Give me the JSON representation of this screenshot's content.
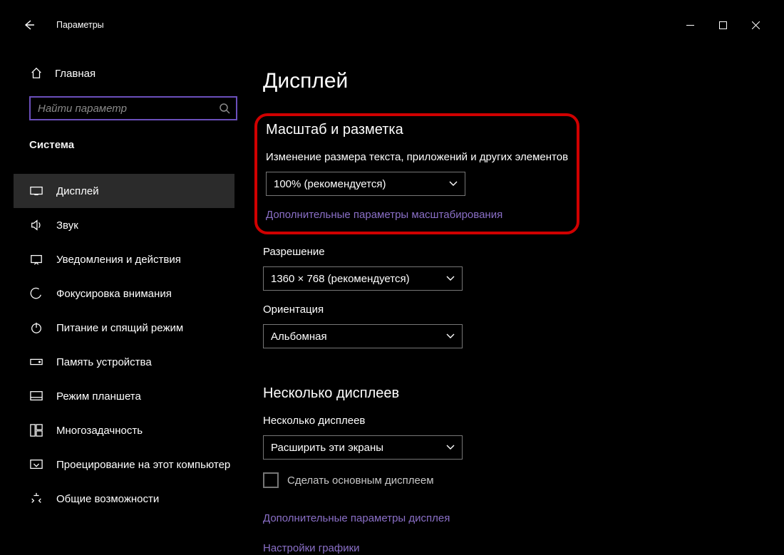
{
  "titlebar": {
    "title": "Параметры"
  },
  "sidebar": {
    "home": "Главная",
    "search_placeholder": "Найти параметр",
    "category": "Система",
    "items": [
      {
        "label": "Дисплей"
      },
      {
        "label": "Звук"
      },
      {
        "label": "Уведомления и действия"
      },
      {
        "label": "Фокусировка внимания"
      },
      {
        "label": "Питание и спящий режим"
      },
      {
        "label": "Память устройства"
      },
      {
        "label": "Режим планшета"
      },
      {
        "label": "Многозадачность"
      },
      {
        "label": "Проецирование на этот компьютер"
      },
      {
        "label": "Общие возможности"
      }
    ]
  },
  "main": {
    "page_title": "Дисплей",
    "scale": {
      "section_title": "Масштаб и разметка",
      "label": "Изменение размера текста, приложений и других элементов",
      "value": "100% (рекомендуется)",
      "advanced_link": "Дополнительные параметры масштабирования"
    },
    "resolution": {
      "label": "Разрешение",
      "value": "1360 × 768 (рекомендуется)"
    },
    "orientation": {
      "label": "Ориентация",
      "value": "Альбомная"
    },
    "multi": {
      "section_title": "Несколько дисплеев",
      "label": "Несколько дисплеев",
      "value": "Расширить эти экраны",
      "make_main_label": "Сделать основным дисплеем",
      "advanced_link": "Дополнительные параметры дисплея",
      "graphics_link": "Настройки графики"
    }
  }
}
